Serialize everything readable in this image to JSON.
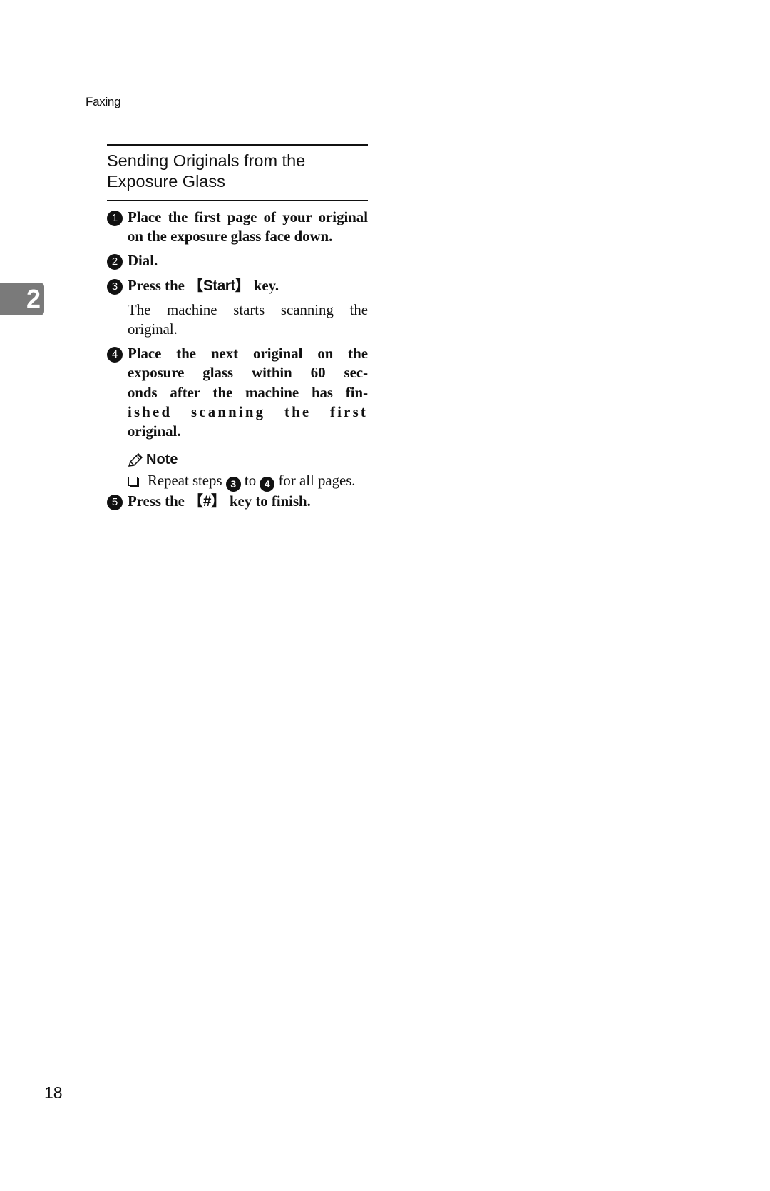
{
  "header": {
    "running_title": "Faxing"
  },
  "chapter_tab": {
    "number": "2"
  },
  "section": {
    "title_line1": "Sending Originals from the",
    "title_line2": "Exposure Glass"
  },
  "steps": [
    {
      "number": "1",
      "text": "Place the first page of your original on the exposure glass face down."
    },
    {
      "number": "2",
      "text": "Dial."
    },
    {
      "number": "3",
      "prefix": "Press the ",
      "bracket_open": "【",
      "key": "Start",
      "bracket_close": "】",
      "suffix": " key.",
      "body": "The machine starts scanning the original."
    },
    {
      "number": "4",
      "line1": "Place the next original on the exposure glass within 60 sec-",
      "line2": "onds after the machine has fin-",
      "line3": "ished scanning the first",
      "line4": "original."
    },
    {
      "number": "5",
      "prefix": "Press the ",
      "bracket_open": "【",
      "key": "#",
      "bracket_close": "】",
      "suffix": " key to finish."
    }
  ],
  "note": {
    "icon": "pencil-icon",
    "heading": "Note",
    "item": {
      "prefix": "Repeat steps ",
      "from_step": "3",
      "middle": " to ",
      "to_step": "4",
      "suffix": " for all pages."
    }
  },
  "footer": {
    "page_number": "18"
  }
}
